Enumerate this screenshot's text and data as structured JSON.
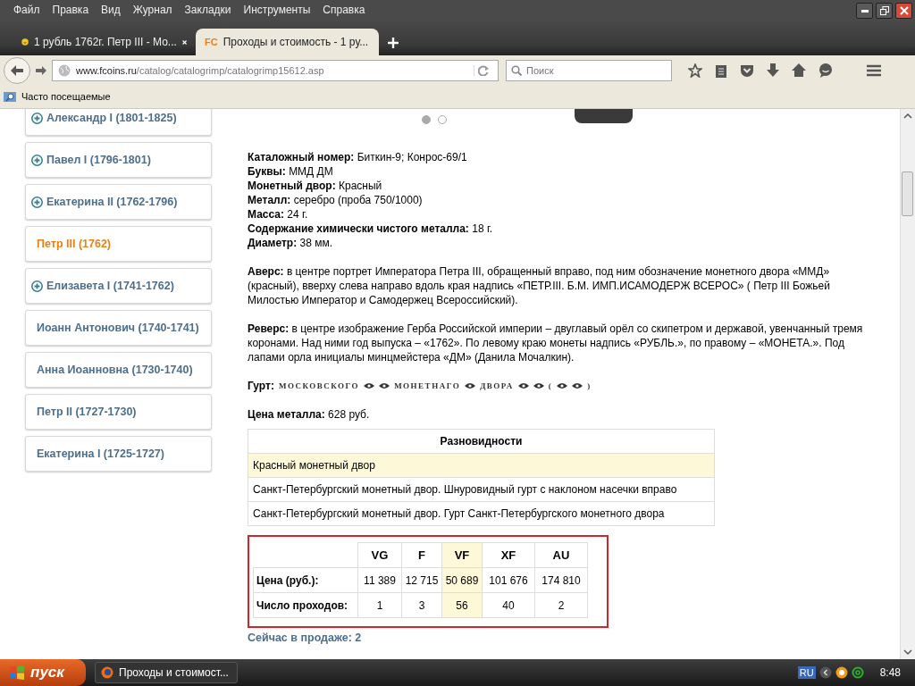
{
  "menu": [
    "Файл",
    "Правка",
    "Вид",
    "Журнал",
    "Закладки",
    "Инструменты",
    "Справка"
  ],
  "tabs": [
    {
      "title": "1 рубль 1762г. Петр III - Мо...",
      "selected": false
    },
    {
      "title": "Проходы и стоимость - 1 ру...",
      "favicon": "FC",
      "selected": true
    }
  ],
  "url": {
    "host": "www.fcoins.ru",
    "path": "/catalog/catalogrimp/catalogrimp15612.asp"
  },
  "search": {
    "placeholder": "Поиск"
  },
  "bookmarks": [
    "Часто посещаемые"
  ],
  "sidebar": {
    "items": [
      {
        "label": "Александр I (1801-1825)",
        "expandable": true,
        "selected": false
      },
      {
        "label": "Павел I (1796-1801)",
        "expandable": true,
        "selected": false
      },
      {
        "label": "Екатерина II (1762-1796)",
        "expandable": true,
        "selected": false
      },
      {
        "label": "Петр III (1762)",
        "expandable": false,
        "selected": true
      },
      {
        "label": "Елизавета I (1741-1762)",
        "expandable": true,
        "selected": false
      },
      {
        "label": "Иоанн Антонович (1740-1741)",
        "expandable": false,
        "selected": false
      },
      {
        "label": "Анна Иоанновна (1730-1740)",
        "expandable": false,
        "selected": false
      },
      {
        "label": "Петр II (1727-1730)",
        "expandable": false,
        "selected": false
      },
      {
        "label": "Екатерина I (1725-1727)",
        "expandable": false,
        "selected": false
      }
    ]
  },
  "carousel": {
    "dots": [
      {
        "selected": true
      },
      {
        "selected": false
      }
    ]
  },
  "properties": [
    {
      "label": "Каталожный номер:",
      "value": "Биткин-9; Конрос-69/1"
    },
    {
      "label": "Буквы:",
      "value": "ММД ДМ"
    },
    {
      "label": "Монетный двор:",
      "value": "Красный"
    },
    {
      "label": "Металл:",
      "value": "серебро (проба 750/1000)"
    },
    {
      "label": "Масса:",
      "value": "24 г."
    },
    {
      "label": "Содержание химически чистого металла:",
      "value": "18 г."
    },
    {
      "label": "Диаметр:",
      "value": "38 мм."
    }
  ],
  "descriptions": [
    "**Аверс:** в центре портрет Императора Петра III, обращенный вправо, под ним обозначение монетного двора «ММД» (красный), вверху слева направо вдоль края надпись «ПЕТР.III. Б.М. ИМП.ИСАМОДЕРЖ ВСЕРОС» ( Петр III Божьей Милостью Император и Самодержец Всероссийский).",
    "**Реверс:** в центре изображение Герба Российской империи – двуглавый орёл со скипетром и державой, увенчанный тремя коронами. Над ними год выпуска – «1762». По левому краю монеты надпись «РУБЛЬ.», по правому – «МОНЕТА.». Под лапами орла инициалы минцмейстера «ДМ» (Данила Мочалкин)."
  ],
  "gurt": {
    "label": "Гурт:",
    "parts": [
      {
        "kind": "word",
        "text": "МОСКОВСКОГО"
      },
      {
        "kind": "ornament"
      },
      {
        "kind": "ornament"
      },
      {
        "kind": "word",
        "text": "МОНЕТНАГО"
      },
      {
        "kind": "ornament"
      },
      {
        "kind": "word",
        "text": "ДВОРА"
      },
      {
        "kind": "ornament"
      },
      {
        "kind": "ornament"
      },
      {
        "kind": "word",
        "text": "("
      },
      {
        "kind": "ornament"
      },
      {
        "kind": "ornament"
      },
      {
        "kind": "word",
        "text": ")"
      }
    ]
  },
  "metal_price": {
    "label": "Цена металла:",
    "value": "628 руб."
  },
  "varieties": {
    "title": "Разновидности",
    "rows": [
      {
        "text": "Красный монетный двор",
        "selected": true
      },
      {
        "text": "Санкт-Петербургский монетный двор. Шнуровидный гурт с наклоном насечки вправо",
        "selected": false
      },
      {
        "text": "Санкт-Петербургский монетный двор. Гурт Санкт-Петербургского монетного двора",
        "selected": false
      }
    ]
  },
  "grades": {
    "columns": [
      {
        "label": "VG",
        "selected": false
      },
      {
        "label": "F",
        "selected": false
      },
      {
        "label": "VF",
        "selected": true
      },
      {
        "label": "XF",
        "selected": false
      },
      {
        "label": "AU",
        "selected": false
      }
    ],
    "rows": [
      {
        "label": "Цена (руб.):",
        "values": [
          "11 389",
          "12 715",
          "50 689",
          "101 676",
          "174 810"
        ]
      },
      {
        "label": "Число проходов:",
        "values": [
          "1",
          "3",
          "56",
          "40",
          "2"
        ]
      }
    ]
  },
  "on_sale_link": "Сейчас в продаже: 2",
  "taskbar": {
    "start": "пуск",
    "tasks": [
      "Проходы и стоимост..."
    ],
    "language": "RU",
    "clock": "8:48"
  }
}
